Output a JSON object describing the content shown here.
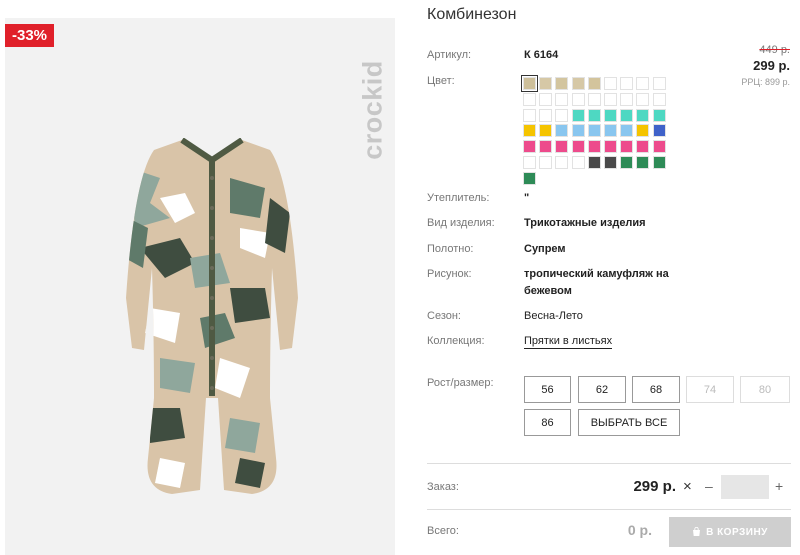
{
  "badge": {
    "discount": "-33%"
  },
  "brand": {
    "logo": "crockid"
  },
  "product": {
    "title": "Комбинезон",
    "sku_label": "Артикул:",
    "sku": "К 6164",
    "color_label": "Цвет:",
    "insulation_label": "Утеплитель:",
    "insulation": "\"",
    "type_label": "Вид изделия:",
    "type": "Трикотажные изделия",
    "fabric_label": "Полотно:",
    "fabric": "Супрем",
    "pattern_label": "Рисунок:",
    "pattern_line1": "тропический камуфляж на",
    "pattern_line2": "бежевом",
    "season_label": "Сезон:",
    "season": "Весна-Лето",
    "collection_label": "Коллекция:",
    "collection": "Прятки в листьях"
  },
  "price": {
    "old": "449 р.",
    "current": "299 р.",
    "rrp": "РРЦ: 899 р."
  },
  "swatch_colors": [
    [
      "#cdbf9a",
      "#d6c8a6",
      "#d3c59f",
      "#d6c8a6",
      "#d3c49c",
      "#ffffff",
      "#ffffff",
      "#ffffff",
      "#ffffff"
    ],
    [
      "#ffffff",
      "#ffffff",
      "#ffffff",
      "#ffffff",
      "#ffffff",
      "#ffffff",
      "#ffffff",
      "#ffffff",
      "#ffffff"
    ],
    [
      "#ffffff",
      "#ffffff",
      "#ffffff",
      "#4ed8c2",
      "#4ed8c2",
      "#4ed8c2",
      "#4ed8c2",
      "#4ed8c2",
      "#4ed8c2"
    ],
    [
      "#f5c400",
      "#f5c400",
      "#89c6ef",
      "#89c6ef",
      "#89c6ef",
      "#89c6ef",
      "#89c6ef",
      "#f5c400",
      "#3f62c9"
    ],
    [
      "#ed4b8c",
      "#ed4b8c",
      "#ed4b8c",
      "#ed4b8c",
      "#ed4b8c",
      "#ed4b8c",
      "#ed4b8c",
      "#ed4b8c",
      "#ed4b8c"
    ],
    [
      "#ffffff",
      "#ffffff",
      "#ffffff",
      "#ffffff",
      "#4a4a4a",
      "#4a4a4a",
      "#2e8b57",
      "#2e8b57",
      "#2e8b57"
    ],
    [
      "#2e8b57"
    ]
  ],
  "sizes": {
    "label": "Рост/размер:",
    "items": [
      "56",
      "62",
      "68",
      "74",
      "80",
      "86"
    ],
    "select_all": "ВЫБРАТЬ ВСЕ"
  },
  "order": {
    "label": "Заказ:",
    "price": "299 р.",
    "times": "×",
    "minus": "–",
    "plus": "+"
  },
  "total": {
    "label": "Всего:",
    "value": "0 р.",
    "cart_button": "В КОРЗИНУ"
  },
  "colors": {
    "discount_badge": "#e0202a",
    "garment_base": "#d9c4a8",
    "garment_trim": "#4f5a43",
    "cart_disabled": "#cfcfcf"
  }
}
